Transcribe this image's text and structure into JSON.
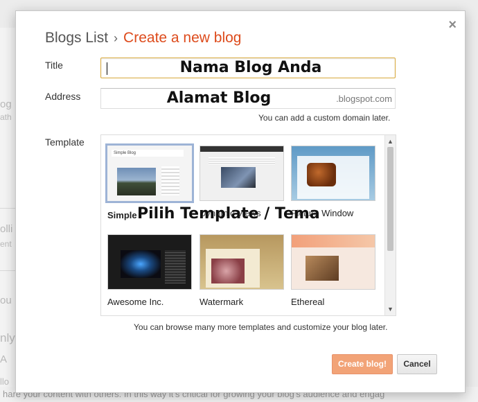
{
  "background": {
    "fragments": [
      "og",
      "ath",
      "olli",
      "ent",
      "ou",
      "nly",
      "A",
      "llo"
    ],
    "bottom_text": "hare your content with others. In this way it's critical for growing your blog's audience and engag"
  },
  "dialog": {
    "breadcrumb_link": "Blogs List",
    "breadcrumb_separator": "›",
    "current_title": "Create a new blog",
    "close_symbol": "×",
    "title_label": "Title",
    "title_value": "Nama Blog Anda",
    "address_label": "Address",
    "address_value": "Alamat Blog",
    "address_suffix": ".blogspot.com",
    "address_hint": "You can add a custom domain later.",
    "template_label": "Template",
    "templates": [
      {
        "name": "Simple",
        "selected": true
      },
      {
        "name": "Dynamic Views",
        "selected": false
      },
      {
        "name": "Picture Window",
        "selected": false
      },
      {
        "name": "Awesome Inc.",
        "selected": false
      },
      {
        "name": "Watermark",
        "selected": false
      },
      {
        "name": "Ethereal",
        "selected": false
      }
    ],
    "template_overlay": "Pilih Template / Tema",
    "template_hint": "You can browse many more templates and customize your blog later.",
    "create_button": "Create blog!",
    "cancel_button": "Cancel"
  },
  "colors": {
    "accent": "#dd4b1c",
    "create_button_bg": "#f2a377",
    "focus_border": "#d9a93b",
    "selected_border": "#9db3d6"
  }
}
